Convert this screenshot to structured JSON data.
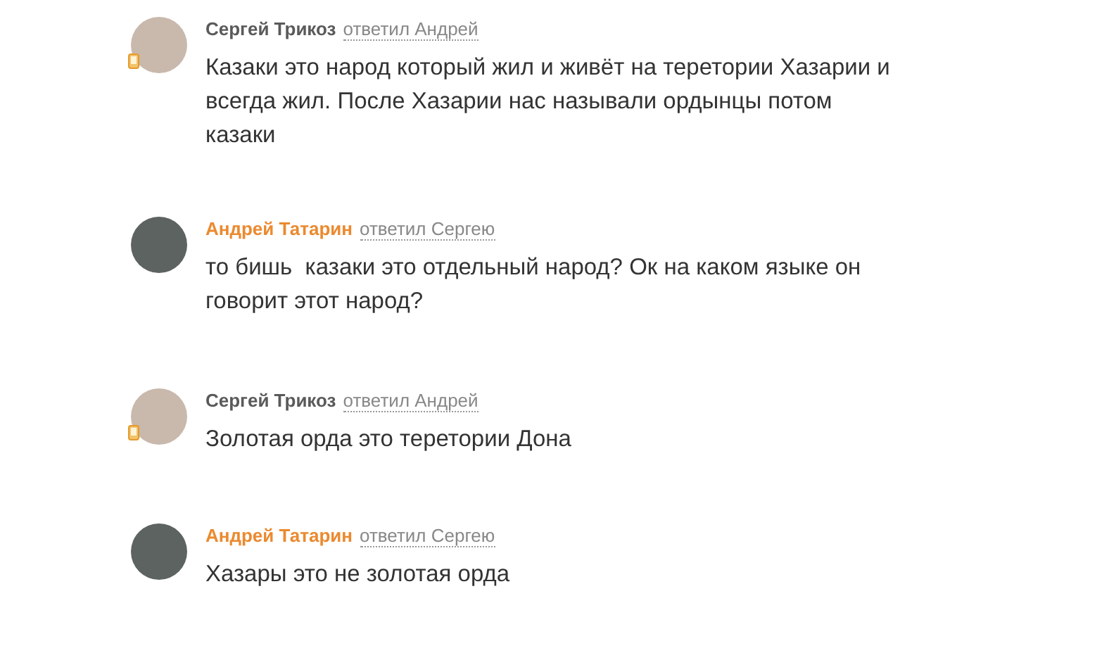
{
  "comments": [
    {
      "author": "Сергей Трикоз",
      "highlighted": false,
      "mobile": true,
      "reply_to": "ответил Андрей",
      "text": "Казаки это народ который жил и живёт на теретории Хазарии и всегда жил. После Хазарии нас называли ордынцы потом казаки"
    },
    {
      "author": "Андрей Татарин",
      "highlighted": true,
      "mobile": false,
      "reply_to": "ответил Сергею",
      "text": "то бишь  казаки это отдельный народ? Ок на каком языке он говорит этот народ?"
    },
    {
      "author": "Сергей Трикоз",
      "highlighted": false,
      "mobile": true,
      "reply_to": "ответил Андрей",
      "text": "Золотая орда это теретории Дона"
    },
    {
      "author": "Андрей Татарин",
      "highlighted": true,
      "mobile": false,
      "reply_to": "ответил Сергею",
      "text": "Хазары это не золотая орда"
    }
  ]
}
